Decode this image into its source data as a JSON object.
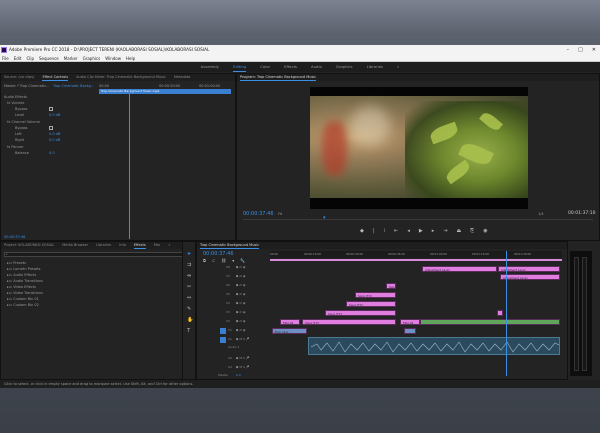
{
  "window": {
    "title": "Adobe Premiere Pro CC 2018 - D:\\PROJECT TERENI (KAOLABORASI SOSIAL)\\KOLABORASI SOSIAL",
    "controls": [
      "–",
      "□",
      "✕"
    ]
  },
  "menu": [
    "File",
    "Edit",
    "Clip",
    "Sequence",
    "Marker",
    "Graphics",
    "Window",
    "Help"
  ],
  "workspaces": {
    "items": [
      "Assembly",
      "Editing",
      "Color",
      "Effects",
      "Audio",
      "Graphics",
      "Libraries"
    ],
    "active": "Editing",
    "more": "»"
  },
  "effect_controls": {
    "tabs": [
      "Source: (no clips)",
      "Effect Controls",
      "Audio Clip Mixer: Trop Cinematic Background Music",
      "Metadata"
    ],
    "active_tab": "Effect Controls",
    "master": "Master * Trop Cinematic...",
    "clip": "Trop Cinematic Backg...",
    "timecodes": [
      "00;00",
      "00:00:20:00",
      "00:01:00:00"
    ],
    "clip_bar": "Trop Cinematic Background Music.mp4",
    "section": "Audio Effects",
    "rows": [
      {
        "label": "fx  Volume",
        "value": ""
      },
      {
        "label": "Bypass",
        "value": ""
      },
      {
        "label": "Level",
        "value": "0.0 dB"
      },
      {
        "label": "fx  Channel Volume",
        "value": ""
      },
      {
        "label": "Bypass",
        "value": ""
      },
      {
        "label": "Left",
        "value": "0.0 dB"
      },
      {
        "label": "Right",
        "value": "0.0 dB"
      },
      {
        "label": "fx  Panner",
        "value": ""
      },
      {
        "label": "Balance",
        "value": "0.0"
      }
    ],
    "timecode": "00:00:37:46"
  },
  "program": {
    "title": "Program: Trop Cinematic Background Music",
    "timecode": "00:00:37:46",
    "fit": "Fit",
    "duration": "00:01:37:10",
    "quality": "1/4"
  },
  "project": {
    "tabs": [
      "Project: KOLABORASI SOSIAL",
      "Media Browser",
      "Libraries",
      "Info",
      "Effects",
      "Mar",
      "»"
    ],
    "active_tab": "Effects",
    "folders": [
      "Presets",
      "Lumetri Presets",
      "Audio Effects",
      "Audio Transitions",
      "Video Effects",
      "Video Transitions",
      "Custom Bin 01",
      "Custom Bin 02"
    ]
  },
  "timeline": {
    "tab": "Trop Cinematic Background Music",
    "timecode": "00:00:37:46",
    "ruler": [
      "00:00",
      "00:00:15:00",
      "00:00:30:00",
      "00:00:45:00",
      "00:01:00:00",
      "00:01:15:00",
      "00:01:30:00"
    ],
    "video_tracks": [
      "V8",
      "V7",
      "V6",
      "V5",
      "V4",
      "V3",
      "V2",
      "V1"
    ],
    "audio_tracks": [
      "A1",
      "A2",
      "A3"
    ],
    "audio_label": "Audio 1",
    "master": "Master",
    "master_value": "0.0",
    "clips": {
      "adjustment": "Adjustment Layer",
      "song": "Song [TX]",
      "text": "Title 01",
      "v1": "Trop Cine..."
    }
  },
  "status": "Click to select, or click in empty space and drag to marquee select. Use Shift, Alt, and Ctrl for other options."
}
